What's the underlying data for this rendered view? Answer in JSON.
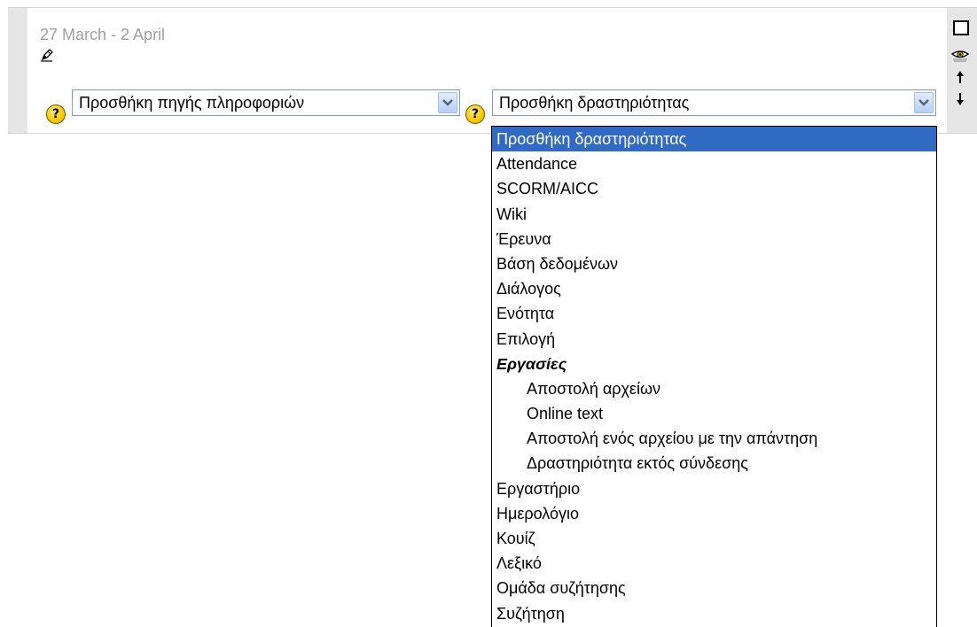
{
  "section": {
    "week_title": "27 March - 2 April"
  },
  "resource_select": {
    "value": "Προσθήκη πηγής πληροφοριών"
  },
  "activity_select": {
    "value": "Προσθήκη δραστηριότητας",
    "options": [
      {
        "label": "Προσθήκη δραστηριότητας",
        "selected": true
      },
      {
        "label": "Attendance"
      },
      {
        "label": "SCORM/AICC"
      },
      {
        "label": "Wiki"
      },
      {
        "label": "Έρευνα"
      },
      {
        "label": "Βάση δεδομένων"
      },
      {
        "label": "Διάλογος"
      },
      {
        "label": "Ενότητα"
      },
      {
        "label": "Επιλογή"
      },
      {
        "label": "Εργασίες",
        "group": true
      },
      {
        "label": "Αποστολή αρχείων",
        "child": true
      },
      {
        "label": "Online text",
        "child": true
      },
      {
        "label": "Αποστολή ενός αρχείου με την απάντηση",
        "child": true
      },
      {
        "label": "Δραστηριότητα εκτός σύνδεσης",
        "child": true
      },
      {
        "label": "Εργαστήριο"
      },
      {
        "label": "Ημερολόγιο"
      },
      {
        "label": "Κουίζ"
      },
      {
        "label": "Λεξικό"
      },
      {
        "label": "Ομάδα συζήτησης"
      },
      {
        "label": "Συζήτηση"
      }
    ]
  },
  "icons": {
    "help": "help-icon",
    "edit": "pencil-icon",
    "highlight": "square-icon",
    "visibility": "eye-icon",
    "move_up": "arrow-up-icon",
    "move_down": "arrow-down-icon",
    "help_glyph": "?"
  },
  "colors": {
    "selected_bg": "#316ac5",
    "section_strip": "#e6e6e6",
    "title_gray": "#a0a0a0"
  }
}
